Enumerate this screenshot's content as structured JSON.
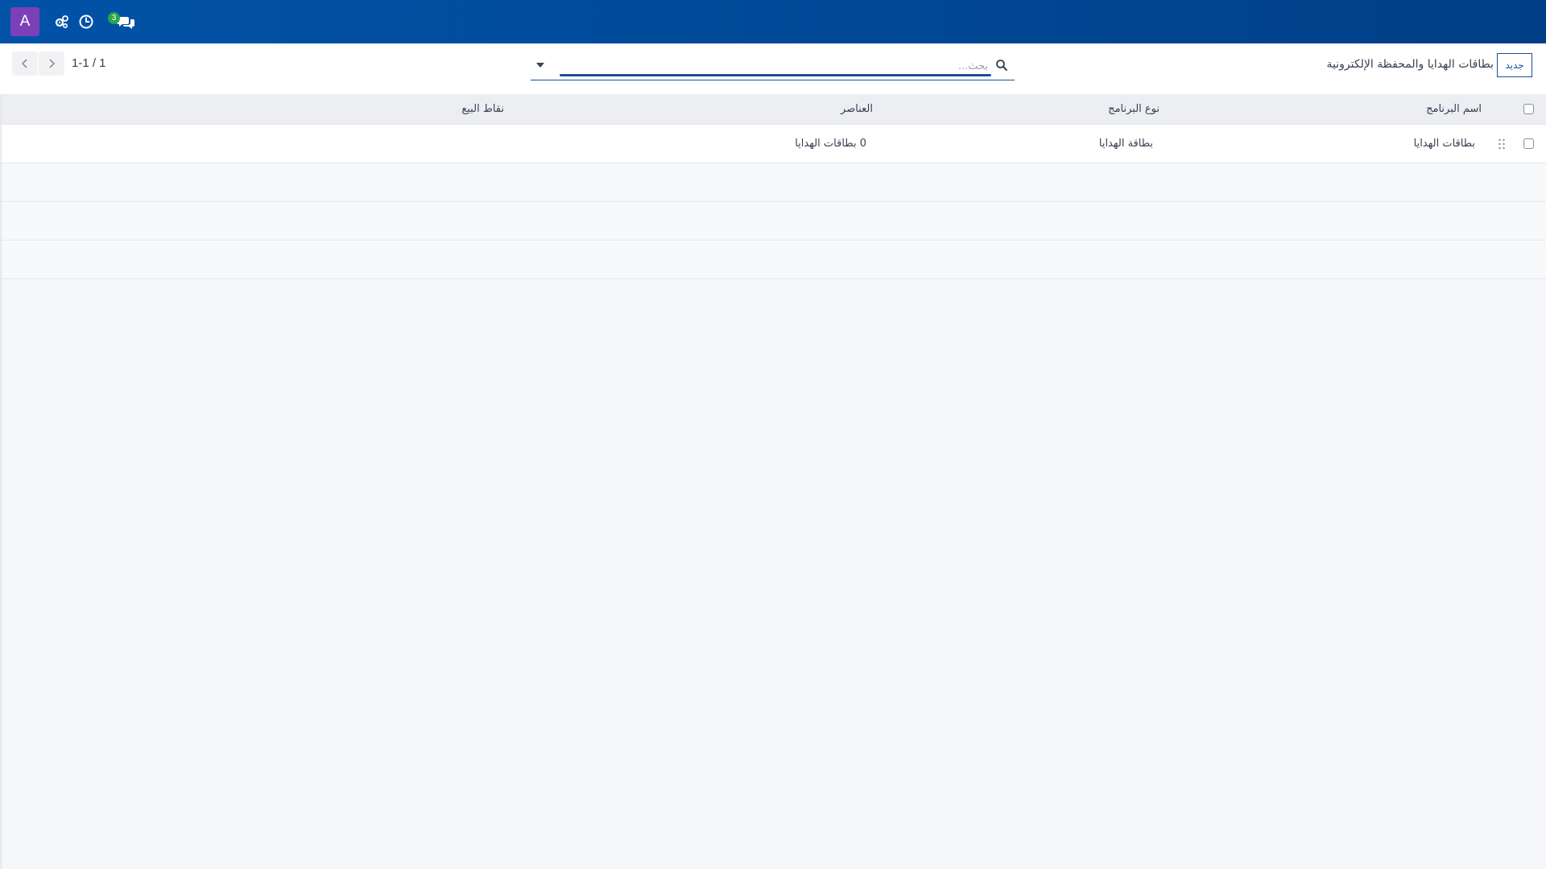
{
  "navbar": {
    "avatar_letter": "A",
    "icons": [
      "users-gear-icon",
      "clock-icon",
      "chat-icon"
    ],
    "chat_badge_count": "3",
    "colors": {
      "bar_start": "#0153a8",
      "bar_end": "#003f87",
      "avatar": "#7b3fb8",
      "badge": "#27a745"
    }
  },
  "control_panel": {
    "new_button_label": "جديد",
    "breadcrumb": "بطاقات الهدايا والمحفظة الإلكترونية",
    "search": {
      "placeholder": "بحث...",
      "value": ""
    },
    "pager": {
      "text": "1-1 / 1"
    }
  },
  "table": {
    "columns": [
      "اسم البرنامج",
      "نوع البرنامج",
      "العناصر",
      "نقاط البيع"
    ],
    "rows": [
      {
        "program_name": "بطاقات الهدايا",
        "program_type": "بطاقة الهدايا",
        "items": "0 بطاقات الهدايا",
        "points_of_sale": ""
      }
    ]
  }
}
